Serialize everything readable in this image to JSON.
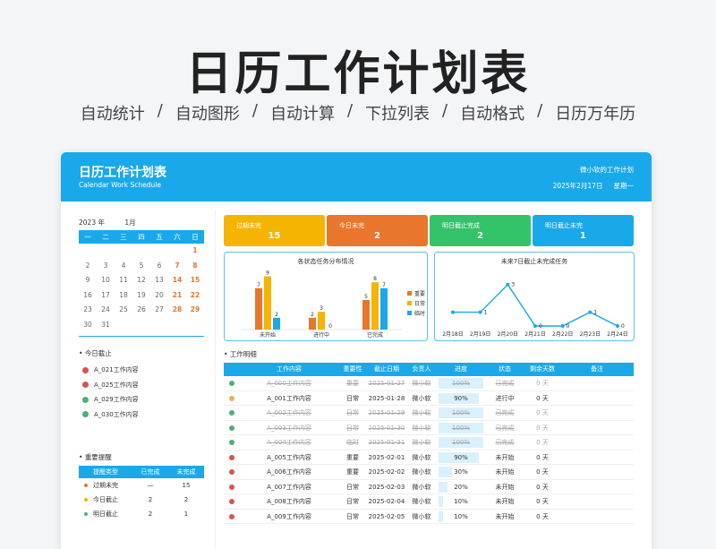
{
  "hero": {
    "title": "日历工作计划表",
    "features": [
      "自动统计",
      "自动图形",
      "自动计算",
      "下拉列表",
      "自动格式",
      "日历万年历"
    ]
  },
  "header": {
    "title": "日历工作计划表",
    "subtitle": "Calendar Work Schedule",
    "owner": "微小软的工作计划",
    "date": "2025年2月17日",
    "weekday": "星期一"
  },
  "calendar": {
    "year": "2023 年",
    "month": "1月",
    "weekdays": [
      "一",
      "二",
      "三",
      "四",
      "五",
      "六",
      "日"
    ],
    "weeks": [
      [
        "",
        "",
        "",
        "",
        "",
        "",
        "1"
      ],
      [
        "2",
        "3",
        "4",
        "5",
        "6",
        "7",
        "8"
      ],
      [
        "9",
        "10",
        "11",
        "12",
        "13",
        "14",
        "15"
      ],
      [
        "16",
        "17",
        "18",
        "19",
        "20",
        "21",
        "22"
      ],
      [
        "23",
        "24",
        "25",
        "26",
        "27",
        "28",
        "29"
      ],
      [
        "30",
        "31",
        "",
        "",
        "",
        "",
        ""
      ]
    ]
  },
  "today_due": {
    "title": "今日截止",
    "items": [
      {
        "label": "A_021工作内容",
        "state": "x"
      },
      {
        "label": "A_025工作内容",
        "state": "x"
      },
      {
        "label": "A_029工作内容",
        "state": "ok"
      },
      {
        "label": "A_030工作内容",
        "state": "ok"
      }
    ]
  },
  "reminders": {
    "title": "重要提醒",
    "headers": [
      "提醒类型",
      "已完成",
      "未完成"
    ],
    "rows": [
      {
        "type": "过期未完",
        "done": "—",
        "undone": "15",
        "color": "#e8762c"
      },
      {
        "type": "今日截止",
        "done": "2",
        "undone": "2",
        "color": "#f5b400"
      },
      {
        "type": "明日截止",
        "done": "2",
        "undone": "1",
        "color": "#4caf7a"
      }
    ]
  },
  "kpis": [
    {
      "label": "过期未完",
      "value": "15",
      "color": "#f5b400"
    },
    {
      "label": "今日未完",
      "value": "2",
      "color": "#e8762c"
    },
    {
      "label": "明日截止完成",
      "value": "2",
      "color": "#34c26b"
    },
    {
      "label": "明日截止未完",
      "value": "1",
      "color": "#19a9ea"
    }
  ],
  "chart_data": [
    {
      "type": "bar",
      "title": "各状态任务分布情况",
      "categories": [
        "未开始",
        "进行中",
        "已完成"
      ],
      "series": [
        {
          "name": "重要",
          "values": [
            7,
            2,
            5
          ],
          "color": "#e8762c"
        },
        {
          "name": "日常",
          "values": [
            9,
            3,
            8
          ],
          "color": "#f5b400"
        },
        {
          "name": "临时",
          "values": [
            2,
            0,
            7
          ],
          "color": "#19a9ea"
        }
      ],
      "ylim": [
        0,
        10
      ]
    },
    {
      "type": "line",
      "title": "未来7日截止未完成任务",
      "categories": [
        "2月18日",
        "2月19日",
        "2月20日",
        "2月21日",
        "2月22日",
        "2月23日",
        "2月24日"
      ],
      "series": [
        {
          "values": [
            1,
            1,
            3,
            0,
            0,
            1,
            0
          ],
          "color": "#19a9ea"
        }
      ],
      "point_labels": [
        "",
        "1",
        "3",
        "0",
        "0",
        "1",
        "0"
      ],
      "ylim": [
        0,
        3.5
      ]
    }
  ],
  "detail": {
    "title": "工作明细",
    "headers": [
      "",
      "工作内容",
      "重要性",
      "截止日期",
      "负责人",
      "进度",
      "状态",
      "剩余天数",
      "备注"
    ],
    "rows": [
      {
        "icon": "ok",
        "name": "A_000工作内容",
        "imp": "重要",
        "date": "2025-01-27",
        "owner": "微小软",
        "progress": 100,
        "prog_label": "100%",
        "status": "已完成",
        "left": "0 天",
        "note": "",
        "done": true
      },
      {
        "icon": "warn",
        "name": "A_001工作内容",
        "imp": "日常",
        "date": "2025-01-28",
        "owner": "微小软",
        "progress": 90,
        "prog_label": "90%",
        "status": "进行中",
        "left": "0 天",
        "note": "",
        "done": false
      },
      {
        "icon": "ok",
        "name": "A_002工作内容",
        "imp": "日常",
        "date": "2025-01-29",
        "owner": "微小软",
        "progress": 100,
        "prog_label": "100%",
        "status": "已完成",
        "left": "0 天",
        "note": "",
        "done": true
      },
      {
        "icon": "ok",
        "name": "A_003工作内容",
        "imp": "日常",
        "date": "2025-01-30",
        "owner": "微小软",
        "progress": 100,
        "prog_label": "100%",
        "status": "已完成",
        "left": "0 天",
        "note": "",
        "done": true
      },
      {
        "icon": "ok",
        "name": "A_004工作内容",
        "imp": "临时",
        "date": "2025-01-31",
        "owner": "微小软",
        "progress": 100,
        "prog_label": "100%",
        "status": "已完成",
        "left": "0 天",
        "note": "",
        "done": true
      },
      {
        "icon": "x",
        "name": "A_005工作内容",
        "imp": "重要",
        "date": "2025-02-01",
        "owner": "微小软",
        "progress": 90,
        "prog_label": "90%",
        "status": "未开始",
        "left": "0 天",
        "note": "",
        "done": false
      },
      {
        "icon": "x",
        "name": "A_006工作内容",
        "imp": "重要",
        "date": "2025-02-02",
        "owner": "微小软",
        "progress": 30,
        "prog_label": "30%",
        "status": "未开始",
        "left": "0 天",
        "note": "",
        "done": false
      },
      {
        "icon": "x",
        "name": "A_007工作内容",
        "imp": "日常",
        "date": "2025-02-03",
        "owner": "微小软",
        "progress": 20,
        "prog_label": "20%",
        "status": "未开始",
        "left": "0 天",
        "note": "",
        "done": false
      },
      {
        "icon": "x",
        "name": "A_008工作内容",
        "imp": "日常",
        "date": "2025-02-04",
        "owner": "微小软",
        "progress": 10,
        "prog_label": "10%",
        "status": "未开始",
        "left": "0 天",
        "note": "",
        "done": false
      },
      {
        "icon": "x",
        "name": "A_009工作内容",
        "imp": "日常",
        "date": "2025-02-05",
        "owner": "微小软",
        "progress": 10,
        "prog_label": "10%",
        "status": "未开始",
        "left": "0 天",
        "note": "",
        "done": false
      }
    ]
  }
}
